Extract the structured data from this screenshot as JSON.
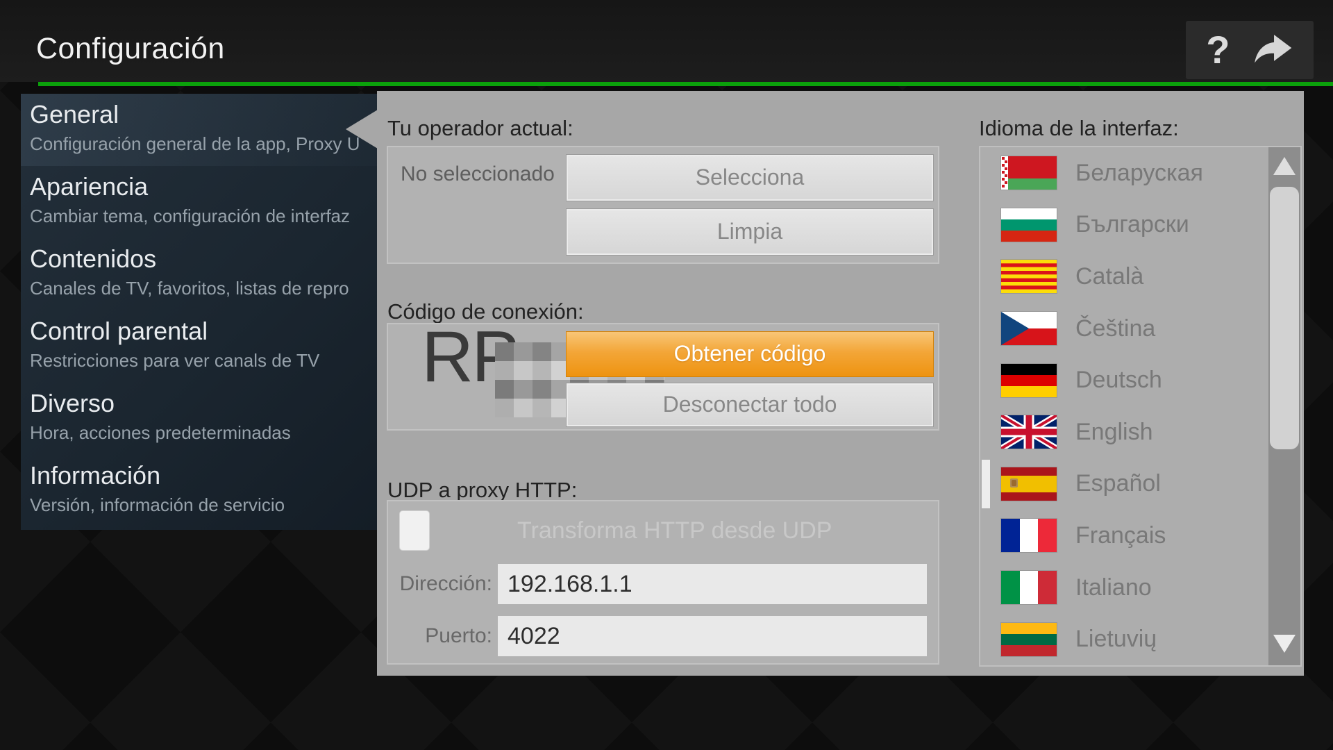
{
  "header": {
    "title": "Configuración",
    "help_glyph": "?",
    "exit_icon": "curved-share-arrow"
  },
  "colors": {
    "accent_green": "#0ba10b",
    "accent_orange": "#f3a638",
    "panel_gray": "#a7a7a7",
    "sidebar_navy": "#1b2630"
  },
  "sidebar": {
    "items": [
      {
        "title": "General",
        "subtitle": "Configuración general de la app, Proxy U",
        "selected": true
      },
      {
        "title": "Apariencia",
        "subtitle": "Cambiar tema, configuración de interfaz",
        "selected": false
      },
      {
        "title": "Contenidos",
        "subtitle": "Canales de TV, favoritos, listas de repro",
        "selected": false
      },
      {
        "title": "Control parental",
        "subtitle": "Restricciones para ver canals de TV",
        "selected": false
      },
      {
        "title": "Diverso",
        "subtitle": "Hora, acciones predeterminadas",
        "selected": false
      },
      {
        "title": "Información",
        "subtitle": "Versión, información de servicio",
        "selected": false
      }
    ]
  },
  "operator": {
    "label": "Tu operador actual:",
    "value": "No seleccionado",
    "select_button": "Selecciona",
    "clear_button": "Limpia"
  },
  "connection": {
    "label": "Código de conexión:",
    "code_visible_prefix": "RP",
    "code_censored": true,
    "get_button": "Obtener código",
    "disconnect_button": "Desconectar todo"
  },
  "udp_proxy": {
    "label": "UDP a proxy HTTP:",
    "checkbox_label": "Transforma HTTP desde UDP",
    "checkbox_checked": false,
    "address_label": "Dirección:",
    "address_value": "192.168.1.1",
    "port_label": "Puerto:",
    "port_value": "4022"
  },
  "language": {
    "label": "Idioma de la interfaz:",
    "selected": "Español",
    "items": [
      {
        "name": "Беларуская",
        "flag": "by"
      },
      {
        "name": "Български",
        "flag": "bg"
      },
      {
        "name": "Català",
        "flag": "ca"
      },
      {
        "name": "Čeština",
        "flag": "cz"
      },
      {
        "name": "Deutsch",
        "flag": "de"
      },
      {
        "name": "English",
        "flag": "gb"
      },
      {
        "name": "Español",
        "flag": "es"
      },
      {
        "name": "Français",
        "flag": "fr"
      },
      {
        "name": "Italiano",
        "flag": "it"
      },
      {
        "name": "Lietuvių",
        "flag": "lt"
      }
    ]
  }
}
